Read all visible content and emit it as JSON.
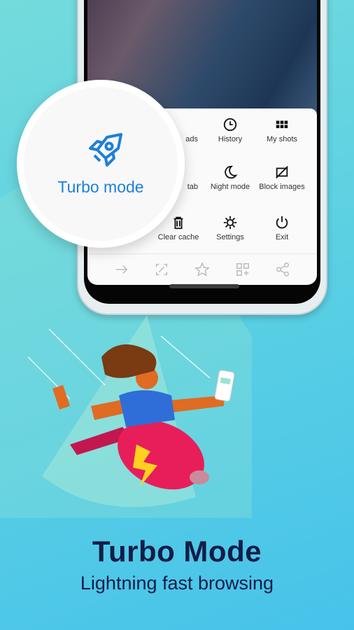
{
  "menu": {
    "items": [
      {
        "label": "ads",
        "icon": "download-icon"
      },
      {
        "label": "History",
        "icon": "clock-icon"
      },
      {
        "label": "My shots",
        "icon": "grid-icon"
      },
      {
        "label": "tab",
        "icon": "tab-icon"
      },
      {
        "label": "Night mode",
        "icon": "moon-icon"
      },
      {
        "label": "Block images",
        "icon": "image-off-icon"
      },
      {
        "label": "Clear cache",
        "icon": "trash-icon"
      },
      {
        "label": "Settings",
        "icon": "gear-icon"
      },
      {
        "label": "Exit",
        "icon": "power-icon"
      }
    ],
    "bottom_bar": [
      "arrow-right-icon",
      "screenshot-icon",
      "star-icon",
      "add-tile-icon",
      "share-icon"
    ]
  },
  "callout": {
    "label": "Turbo mode",
    "icon": "rocket-icon",
    "color": "#1e7fd8"
  },
  "headline": {
    "title": "Turbo Mode",
    "subtitle": "Lightning fast browsing",
    "color": "#131d47"
  }
}
